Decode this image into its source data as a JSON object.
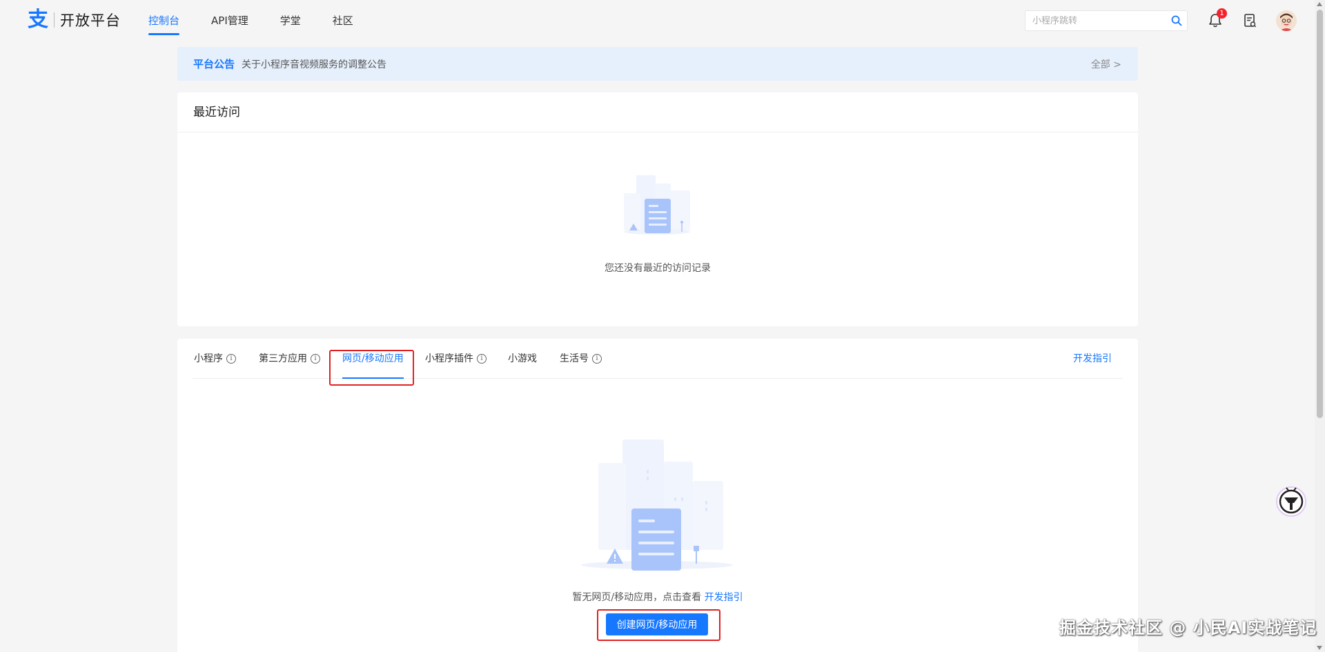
{
  "header": {
    "logo_text": "开放平台",
    "nav": [
      "控制台",
      "API管理",
      "学堂",
      "社区"
    ],
    "search_placeholder": "小程序跳转",
    "notification_count": "1"
  },
  "notice": {
    "title": "平台公告",
    "text": "关于小程序音视频服务的调整公告",
    "all_link": "全部 >"
  },
  "recent": {
    "title": "最近访问",
    "empty_text": "您还没有最近的访问记录"
  },
  "apps": {
    "tabs": [
      {
        "label": "小程序",
        "info": true
      },
      {
        "label": "第三方应用",
        "info": true
      },
      {
        "label": "网页/移动应用",
        "info": false
      },
      {
        "label": "小程序插件",
        "info": true
      },
      {
        "label": "小游戏",
        "info": false
      },
      {
        "label": "生活号",
        "info": true
      }
    ],
    "active_tab": 2,
    "dev_guide": "开发指引",
    "empty_text": "暂无网页/移动应用，点击查看 ",
    "empty_link": "开发指引",
    "create_button": "创建网页/移动应用"
  },
  "watermark": "掘金技术社区 @ 小民AI实战笔记",
  "colors": {
    "accent": "#1677ff",
    "highlight": "#e02020",
    "notice_bg": "#e6f0fc"
  }
}
